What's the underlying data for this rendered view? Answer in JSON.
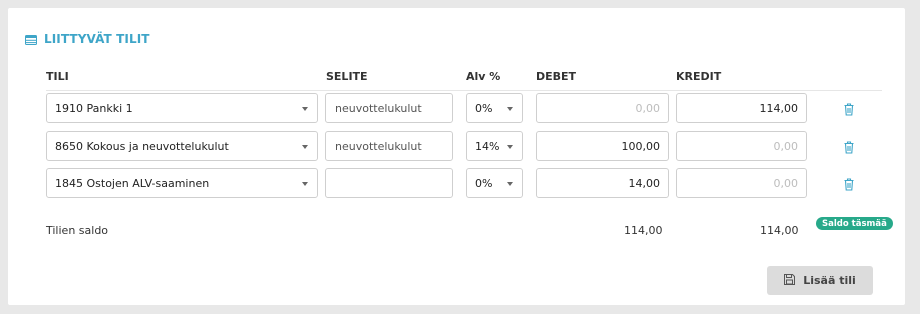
{
  "section": {
    "title": "LIITTYVÄT TILIT",
    "icon": "table-list-icon"
  },
  "columns": {
    "account": "TILI",
    "description": "SELITE",
    "vat": "Alv %",
    "debit": "DEBET",
    "credit": "KREDIT"
  },
  "rows": [
    {
      "account": "1910 Pankki 1",
      "description": "",
      "description_placeholder": "neuvottelukulut",
      "vat": "0%",
      "debit": "0,00",
      "credit": "114,00"
    },
    {
      "account": "8650 Kokous ja neuvottelukulut",
      "description": "",
      "description_placeholder": "neuvottelukulut",
      "vat": "14%",
      "debit": "100,00",
      "credit": "0,00"
    },
    {
      "account": "1845 Ostojen ALV-saaminen",
      "description": "",
      "description_placeholder": "",
      "vat": "0%",
      "debit": "14,00",
      "credit": "0,00"
    }
  ],
  "totals": {
    "label": "Tilien saldo",
    "debit": "114,00",
    "credit": "114,00",
    "badge": "Saldo täsmää"
  },
  "add_button": {
    "label": "Lisää tili",
    "icon": "floppy-disk-icon"
  },
  "colors": {
    "accent": "#3ea5c8",
    "badge": "#27a98a",
    "trash": "#3ea5c8"
  }
}
